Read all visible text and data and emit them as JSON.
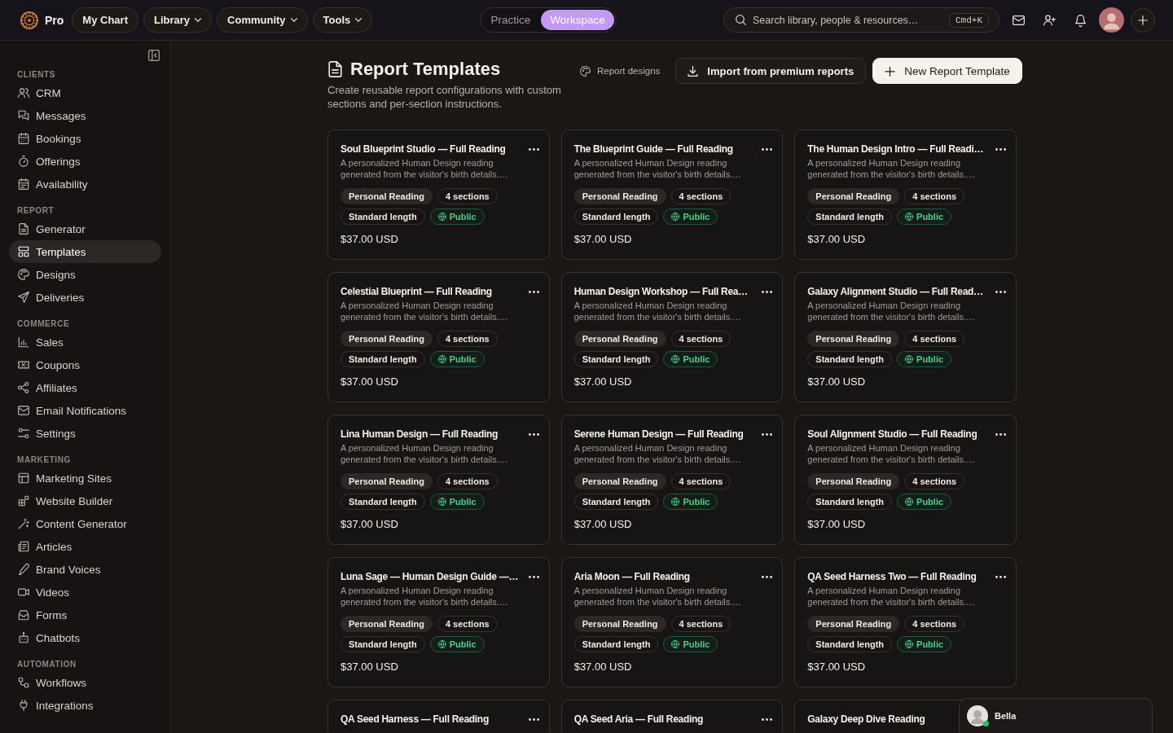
{
  "top_bar": {
    "brand": "Pro",
    "nav": [
      {
        "label": "My Chart",
        "dropdown": false
      },
      {
        "label": "Library",
        "dropdown": true
      },
      {
        "label": "Community",
        "dropdown": true
      },
      {
        "label": "Tools",
        "dropdown": true
      }
    ],
    "mode_switch": [
      {
        "label": "Practice",
        "selected": false
      },
      {
        "label": "Workspace",
        "selected": true
      }
    ],
    "search": {
      "placeholder": "Search library, people & resources…",
      "shortcut": "Cmd+K"
    }
  },
  "sidebar": {
    "sections": [
      {
        "heading": "CLIENTS",
        "items": [
          {
            "label": "CRM",
            "selected": false
          },
          {
            "label": "Messages",
            "selected": false
          },
          {
            "label": "Bookings",
            "selected": false
          },
          {
            "label": "Offerings",
            "selected": false
          },
          {
            "label": "Availability",
            "selected": false
          }
        ]
      },
      {
        "heading": "REPORT",
        "items": [
          {
            "label": "Generator",
            "selected": false
          },
          {
            "label": "Templates",
            "selected": true
          },
          {
            "label": "Designs",
            "selected": false
          },
          {
            "label": "Deliveries",
            "selected": false
          }
        ]
      },
      {
        "heading": "COMMERCE",
        "items": [
          {
            "label": "Sales",
            "selected": false
          },
          {
            "label": "Coupons",
            "selected": false
          },
          {
            "label": "Affiliates",
            "selected": false
          },
          {
            "label": "Email Notifications",
            "selected": false
          },
          {
            "label": "Settings",
            "selected": false
          }
        ]
      },
      {
        "heading": "MARKETING",
        "items": [
          {
            "label": "Marketing Sites",
            "selected": false
          },
          {
            "label": "Website Builder",
            "selected": false
          },
          {
            "label": "Content Generator",
            "selected": false
          },
          {
            "label": "Articles",
            "selected": false
          },
          {
            "label": "Brand Voices",
            "selected": false
          },
          {
            "label": "Videos",
            "selected": false
          },
          {
            "label": "Forms",
            "selected": false
          },
          {
            "label": "Chatbots",
            "selected": false
          }
        ]
      },
      {
        "heading": "AUTOMATION",
        "items": [
          {
            "label": "Workflows",
            "selected": false
          },
          {
            "label": "Integrations",
            "selected": false
          }
        ]
      }
    ]
  },
  "page": {
    "title": "Report Templates",
    "subtitle": "Create reusable report configurations with custom sections and per-section instructions.",
    "designs_link": "Report designs",
    "buttons": [
      {
        "label": "Import from premium reports",
        "kind": "secondary"
      },
      {
        "label": "New Report Template",
        "kind": "primary"
      }
    ]
  },
  "templates": [
    {
      "title": "Soul Blueprint Studio — Full Reading",
      "description": "A personalized Human Design reading generated from the visitor's birth details.…",
      "tags": [
        {
          "label": "Personal Reading",
          "kind": "category"
        },
        {
          "label": "4 sections",
          "kind": "count"
        },
        {
          "label": "Standard length",
          "kind": "length"
        },
        {
          "label": "Public",
          "kind": "visibility"
        }
      ],
      "price": "$37.00 USD",
      "menu": true
    },
    {
      "title": "The Blueprint Guide — Full Reading",
      "description": "A personalized Human Design reading generated from the visitor's birth details.…",
      "tags": [
        {
          "label": "Personal Reading",
          "kind": "category"
        },
        {
          "label": "4 sections",
          "kind": "count"
        },
        {
          "label": "Standard length",
          "kind": "length"
        },
        {
          "label": "Public",
          "kind": "visibility"
        }
      ],
      "price": "$37.00 USD",
      "menu": true
    },
    {
      "title": "The Human Design Intro — Full Readi…",
      "description": "A personalized Human Design reading generated from the visitor's birth details.…",
      "tags": [
        {
          "label": "Personal Reading",
          "kind": "category"
        },
        {
          "label": "4 sections",
          "kind": "count"
        },
        {
          "label": "Standard length",
          "kind": "length"
        },
        {
          "label": "Public",
          "kind": "visibility"
        }
      ],
      "price": "$37.00 USD",
      "menu": true
    },
    {
      "title": "Celestial Blueprint — Full Reading",
      "description": "A personalized Human Design reading generated from the visitor's birth details.…",
      "tags": [
        {
          "label": "Personal Reading",
          "kind": "category"
        },
        {
          "label": "4 sections",
          "kind": "count"
        },
        {
          "label": "Standard length",
          "kind": "length"
        },
        {
          "label": "Public",
          "kind": "visibility"
        }
      ],
      "price": "$37.00 USD",
      "menu": true
    },
    {
      "title": "Human Design Workshop — Full Rea…",
      "description": "A personalized Human Design reading generated from the visitor's birth details.…",
      "tags": [
        {
          "label": "Personal Reading",
          "kind": "category"
        },
        {
          "label": "4 sections",
          "kind": "count"
        },
        {
          "label": "Standard length",
          "kind": "length"
        },
        {
          "label": "Public",
          "kind": "visibility"
        }
      ],
      "price": "$37.00 USD",
      "menu": true
    },
    {
      "title": "Galaxy Alignment Studio — Full Read…",
      "description": "A personalized Human Design reading generated from the visitor's birth details.…",
      "tags": [
        {
          "label": "Personal Reading",
          "kind": "category"
        },
        {
          "label": "4 sections",
          "kind": "count"
        },
        {
          "label": "Standard length",
          "kind": "length"
        },
        {
          "label": "Public",
          "kind": "visibility"
        }
      ],
      "price": "$37.00 USD",
      "menu": true
    },
    {
      "title": "Lina Human Design — Full Reading",
      "description": "A personalized Human Design reading generated from the visitor's birth details.…",
      "tags": [
        {
          "label": "Personal Reading",
          "kind": "category"
        },
        {
          "label": "4 sections",
          "kind": "count"
        },
        {
          "label": "Standard length",
          "kind": "length"
        },
        {
          "label": "Public",
          "kind": "visibility"
        }
      ],
      "price": "$37.00 USD",
      "menu": true
    },
    {
      "title": "Serene Human Design — Full Reading",
      "description": "A personalized Human Design reading generated from the visitor's birth details.…",
      "tags": [
        {
          "label": "Personal Reading",
          "kind": "category"
        },
        {
          "label": "4 sections",
          "kind": "count"
        },
        {
          "label": "Standard length",
          "kind": "length"
        },
        {
          "label": "Public",
          "kind": "visibility"
        }
      ],
      "price": "$37.00 USD",
      "menu": true
    },
    {
      "title": "Soul Alignment Studio — Full Reading",
      "description": "A personalized Human Design reading generated from the visitor's birth details.…",
      "tags": [
        {
          "label": "Personal Reading",
          "kind": "category"
        },
        {
          "label": "4 sections",
          "kind": "count"
        },
        {
          "label": "Standard length",
          "kind": "length"
        },
        {
          "label": "Public",
          "kind": "visibility"
        }
      ],
      "price": "$37.00 USD",
      "menu": true
    },
    {
      "title": "Luna Sage — Human Design Guide —…",
      "description": "A personalized Human Design reading generated from the visitor's birth details.…",
      "tags": [
        {
          "label": "Personal Reading",
          "kind": "category"
        },
        {
          "label": "4 sections",
          "kind": "count"
        },
        {
          "label": "Standard length",
          "kind": "length"
        },
        {
          "label": "Public",
          "kind": "visibility"
        }
      ],
      "price": "$37.00 USD",
      "menu": true
    },
    {
      "title": "Aria Moon — Full Reading",
      "description": "A personalized Human Design reading generated from the visitor's birth details.…",
      "tags": [
        {
          "label": "Personal Reading",
          "kind": "category"
        },
        {
          "label": "4 sections",
          "kind": "count"
        },
        {
          "label": "Standard length",
          "kind": "length"
        },
        {
          "label": "Public",
          "kind": "visibility"
        }
      ],
      "price": "$37.00 USD",
      "menu": true
    },
    {
      "title": "QA Seed Harness Two — Full Reading",
      "description": "A personalized Human Design reading generated from the visitor's birth details.…",
      "tags": [
        {
          "label": "Personal Reading",
          "kind": "category"
        },
        {
          "label": "4 sections",
          "kind": "count"
        },
        {
          "label": "Standard length",
          "kind": "length"
        },
        {
          "label": "Public",
          "kind": "visibility"
        }
      ],
      "price": "$37.00 USD",
      "menu": true
    },
    {
      "title": "QA Seed Harness — Full Reading",
      "menu": true
    },
    {
      "title": "QA Seed Aria — Full Reading",
      "menu": true
    },
    {
      "title": "Galaxy Deep Dive Reading"
    }
  ],
  "chat": {
    "name": "Bella",
    "online": true
  }
}
